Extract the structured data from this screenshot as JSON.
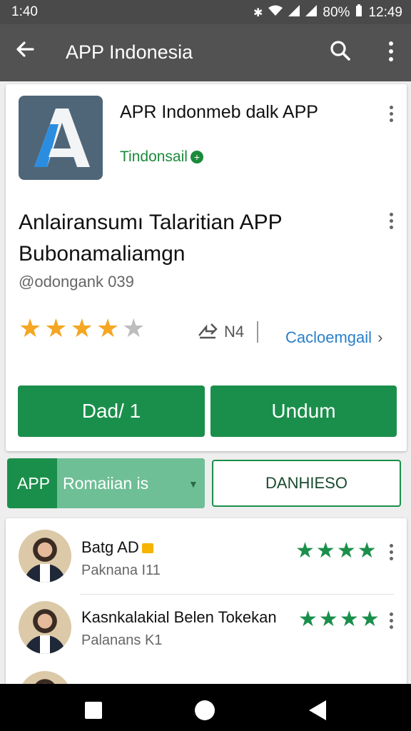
{
  "status_bar": {
    "time_left": "1:40",
    "battery": "80%",
    "time_right": "12:49"
  },
  "app_bar": {
    "title": "APP Indonesia"
  },
  "app": {
    "name": "APR Indonmeb dalk APP",
    "developer": "Tindonsail",
    "headline": "Anlairansumı Talaritian APP Bubonamaliamgn",
    "handle": "@odongank 039",
    "rating": 4,
    "rating_max": 5,
    "share_count": "N4",
    "category": "Cacloemgail"
  },
  "buttons": {
    "left": "Dad/ 1",
    "right": "Undum"
  },
  "tabs": {
    "prefix": "APP",
    "selected": "Romaiian is",
    "outline": "DANHIESO"
  },
  "reviews": [
    {
      "name": "Batg AD",
      "sub": "Paknana I11",
      "stars": 4
    },
    {
      "name": "Kasnkalakial Belen Tokekan",
      "sub": "Palanans K1",
      "stars": 4
    }
  ],
  "colors": {
    "green": "#1a8f4b",
    "star_gold": "#f5a623",
    "link_blue": "#2a7fc9"
  }
}
